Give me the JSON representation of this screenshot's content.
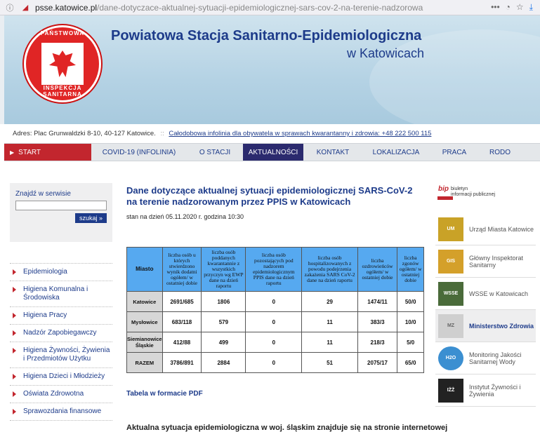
{
  "browser": {
    "url_host": "psse.katowice.pl",
    "url_path": "/dane-dotyczace-aktualnej-sytuacji-epidemiologicznej-sars-cov-2-na-terenie-nadzorowa",
    "more_icon": "•••"
  },
  "header": {
    "title_line1": "Powiatowa Stacja Sanitarno-Epidemiologiczna",
    "title_line2": "w Katowicach",
    "logo_top_text": "PAŃSTWOWA",
    "logo_bottom_text": "INSPEKCJA SANITARNA"
  },
  "address": {
    "label": "Adres:",
    "value": "Plac Grunwaldzki 8-10, 40-127 Katowice.",
    "sep": "::",
    "hotline": "Całodobowa infolinia dla obywatela w sprawach kwarantanny i zdrowia: +48 222 500 115"
  },
  "nav": {
    "start": "START",
    "items": [
      "COVID-19 (INFOLINIA)",
      "O STACJI",
      "AKTUALNOŚCI",
      "KONTAKT",
      "LOKALIZACJA",
      "PRACA",
      "RODO"
    ]
  },
  "sidebar": {
    "search_label": "Znajdź w serwisie",
    "search_button": "szukaj »",
    "menu": [
      "Epidemiologia",
      "Higiena Komunalna i Środowiska",
      "Higiena Pracy",
      "Nadzór Zapobiegawczy",
      "Higiena Żywności, Żywienia i Przedmiotów Użytku",
      "Higiena Dzieci i Młodzieży",
      "Oświata Zdrowotna",
      "Sprawozdania finansowe"
    ]
  },
  "main": {
    "heading": "Dane dotyczące aktualnej sytuacji epidemiologicznej SARS-CoV-2 na terenie nadzorowanym przez PPIS w Katowicach",
    "stan": "stan na dzień 05.11.2020 r. godzina 10:30",
    "table": {
      "headers": [
        "Miasto",
        "liczba osób u których stwierdzono wynik dodatni ogółem/ w ostatniej dobie",
        "liczba osób poddanych kwarantannie z wszystkich przyczyn wg EWP dane na dzień raportu",
        "liczba osób pozostających pod nadzorem epidemiologicznym PPIS dane na dzień raportu",
        "liczba osób hospitalizowanych z powodu podejrzenia zakażenia SARS CoV-2 dane na dzień raportu",
        "liczba ozdrowieńców ogółem/ w ostatniej dobie",
        "liczba zgonów ogółem/ w ostatniej dobie"
      ],
      "rows": [
        [
          "Katowice",
          "2691/685",
          "1806",
          "0",
          "29",
          "1474/11",
          "50/0"
        ],
        [
          "Mysłowice",
          "683/118",
          "579",
          "0",
          "11",
          "383/3",
          "10/0"
        ],
        [
          "Siemianowice Śląskie",
          "412/88",
          "499",
          "0",
          "11",
          "218/3",
          "5/0"
        ],
        [
          "RAZEM",
          "3786/891",
          "2884",
          "0",
          "51",
          "2075/17",
          "65/0"
        ]
      ]
    },
    "pdf_link": "Tabela w formacie PDF",
    "bottom_text": "Aktualna sytuacja epidemiologiczna w woj. śląskim znajduje się na stronie internetowej"
  },
  "right": {
    "bip_logo": "bip",
    "bip_text1": "biuletyn",
    "bip_text2": "informacji publicznej",
    "links": [
      {
        "text": "Urząd Miasta Katowice",
        "badge": "UM",
        "color": "#c9a227"
      },
      {
        "text": "Główny Inspektorat Sanitarny",
        "badge": "GIS",
        "color": "#d4a02a"
      },
      {
        "text": "WSSE w Katowicach",
        "badge": "WSSE",
        "color": "#4a6b3a"
      },
      {
        "text": "Ministerstwo Zdrowia",
        "badge": "MZ",
        "color": "#cfcfcf"
      },
      {
        "text": "Monitoring Jakości Sanitarnej Wody",
        "badge": "H2O",
        "color": "#3b8fd1"
      },
      {
        "text": "Instytut Żywności i Żywienia",
        "badge": "IŻŻ",
        "color": "#222222"
      }
    ]
  }
}
